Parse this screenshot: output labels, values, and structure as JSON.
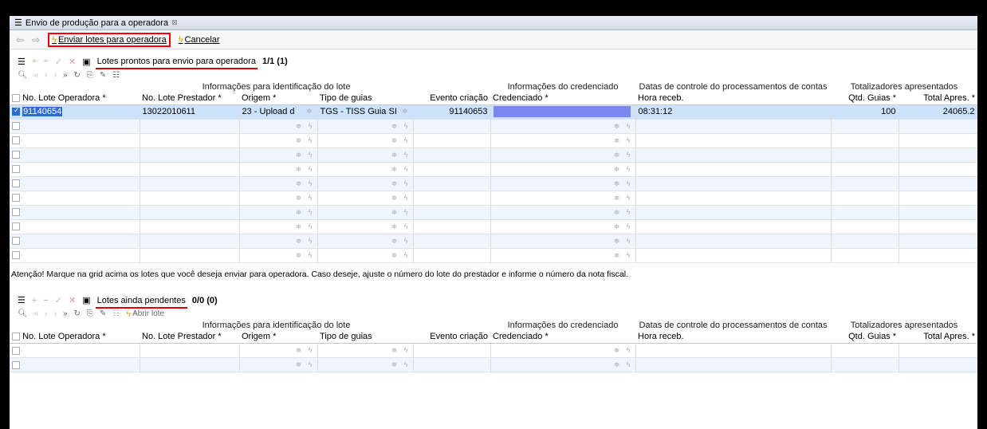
{
  "tab": {
    "title": "Envio de produção para a operadora"
  },
  "toolbar": {
    "send_label": "Enviar lotes para operadora",
    "cancel_label": "Cancelar"
  },
  "headers": {
    "group_ident": "Informações para identificação do lote",
    "group_cred": "Informações do credenciado",
    "group_datas": "Datas de controle do processamentos de contas",
    "group_tot": "Totalizadores apresentados",
    "cols": [
      "No. Lote Operadora *",
      "No. Lote Prestador *",
      "Origem *",
      "Tipo de guias",
      "Evento criação",
      "Credenciado *",
      "Hora receb.",
      "Qtd. Guias *",
      "Total Apres. *"
    ]
  },
  "section1": {
    "title": "Lotes prontos para envio para operadora",
    "count": "1/1 (1)",
    "row": {
      "lote_operadora": "91140654",
      "lote_prestador": "13022010611",
      "origem": "23 - Upload d",
      "tipo_guias": "TGS - TISS Guia SI",
      "evento": "91140653",
      "hora": "08:31:12",
      "qtd": "100",
      "total": "24065.2"
    }
  },
  "note": "Atenção! Marque na grid acima os lotes que você deseja enviar para operadora. Caso deseje, ajuste o número do lote do prestador e informe o número da nota fiscal.",
  "section2": {
    "title": "Lotes ainda pendentes",
    "count": "0/0 (0)",
    "abrir_label": "Abrir lote"
  },
  "colors": {
    "selected_row": "#cde2fb",
    "accent": "#2a6bd6",
    "annotation_red": "#dd0000"
  }
}
